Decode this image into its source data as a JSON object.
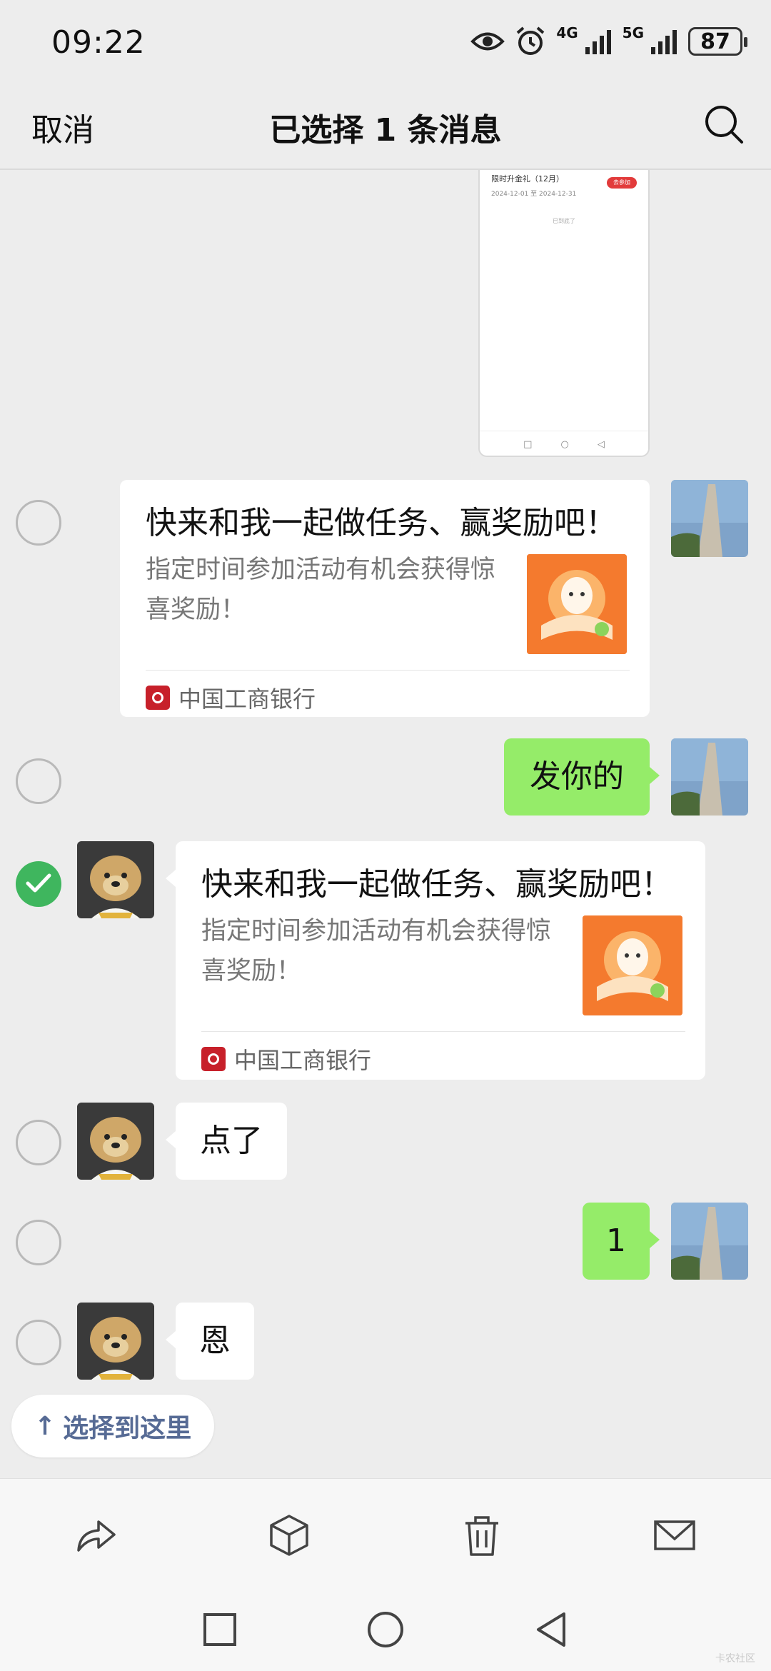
{
  "status_bar": {
    "time": "09:22",
    "net1": "4G",
    "net2": "5G",
    "battery": "87",
    "icons": [
      "eye-icon",
      "alarm-icon",
      "signal-4g-icon",
      "signal-5g-icon",
      "battery-icon"
    ]
  },
  "header": {
    "cancel": "取消",
    "title": "已选择 1 条消息",
    "search_icon": "search-icon"
  },
  "image_message": {
    "line1": "限时升金礼（12月）",
    "line2": "2024-12-01 至 2024-12-31",
    "pill": "去参加",
    "line3": "已到底了"
  },
  "messages": [
    {
      "type": "card",
      "side": "right",
      "selected": false,
      "title": "快来和我一起做任务、赢奖励吧！",
      "desc": "指定时间参加活动有机会获得惊喜奖励！",
      "source": "中国工商银行"
    },
    {
      "type": "text",
      "side": "right",
      "selected": false,
      "text": "发你的"
    },
    {
      "type": "card",
      "side": "left",
      "selected": true,
      "title": "快来和我一起做任务、赢奖励吧！",
      "desc": "指定时间参加活动有机会获得惊喜奖励！",
      "source": "中国工商银行"
    },
    {
      "type": "text",
      "side": "left",
      "selected": false,
      "text": "点了"
    },
    {
      "type": "text",
      "side": "right",
      "selected": false,
      "text": "1"
    },
    {
      "type": "text",
      "side": "left",
      "selected": false,
      "text": "恩"
    }
  ],
  "select_here": {
    "arrow": "↑",
    "label": "选择到这里"
  },
  "actions": [
    {
      "name": "forward",
      "icon": "forward-icon"
    },
    {
      "name": "favorite",
      "icon": "cube-icon"
    },
    {
      "name": "delete",
      "icon": "trash-icon"
    },
    {
      "name": "email",
      "icon": "mail-icon"
    }
  ],
  "colors": {
    "background": "#ededed",
    "green_bubble": "#95ec69",
    "selected_check": "#3fb65e",
    "link_blue": "#576b95",
    "bank_red": "#c7202a"
  },
  "watermark": "卡农社区"
}
